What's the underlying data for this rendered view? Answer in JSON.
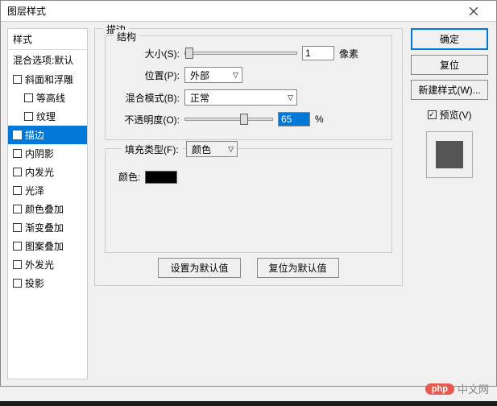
{
  "window": {
    "title": "图层样式"
  },
  "sidebar": {
    "header": "样式",
    "subheader": "混合选项:默认",
    "items": [
      {
        "label": "斜面和浮雕",
        "checked": false,
        "indent": false
      },
      {
        "label": "等高线",
        "checked": false,
        "indent": true
      },
      {
        "label": "纹理",
        "checked": false,
        "indent": true
      },
      {
        "label": "描边",
        "checked": false,
        "indent": false,
        "selected": true
      },
      {
        "label": "内阴影",
        "checked": false,
        "indent": false
      },
      {
        "label": "内发光",
        "checked": false,
        "indent": false
      },
      {
        "label": "光泽",
        "checked": false,
        "indent": false
      },
      {
        "label": "颜色叠加",
        "checked": false,
        "indent": false
      },
      {
        "label": "渐变叠加",
        "checked": false,
        "indent": false
      },
      {
        "label": "图案叠加",
        "checked": false,
        "indent": false
      },
      {
        "label": "外发光",
        "checked": false,
        "indent": false
      },
      {
        "label": "投影",
        "checked": false,
        "indent": false
      }
    ]
  },
  "main": {
    "group_title": "描边",
    "structure_title": "结构",
    "size": {
      "label": "大小(S):",
      "value": "1",
      "unit": "像素"
    },
    "position": {
      "label": "位置(P):",
      "value": "外部"
    },
    "blend_mode": {
      "label": "混合模式(B):",
      "value": "正常"
    },
    "opacity": {
      "label": "不透明度(O):",
      "value": "65",
      "unit": "%"
    },
    "fill_type": {
      "label": "填充类型(F):",
      "value": "颜色"
    },
    "color": {
      "label": "颜色:",
      "value": "#000000"
    },
    "defaults": {
      "set": "设置为默认值",
      "reset": "复位为默认值"
    }
  },
  "right": {
    "ok": "确定",
    "cancel": "复位",
    "new_style": "新建样式(W)...",
    "preview_label": "预览(V)"
  },
  "watermark": {
    "badge": "php",
    "text": "中文网"
  }
}
